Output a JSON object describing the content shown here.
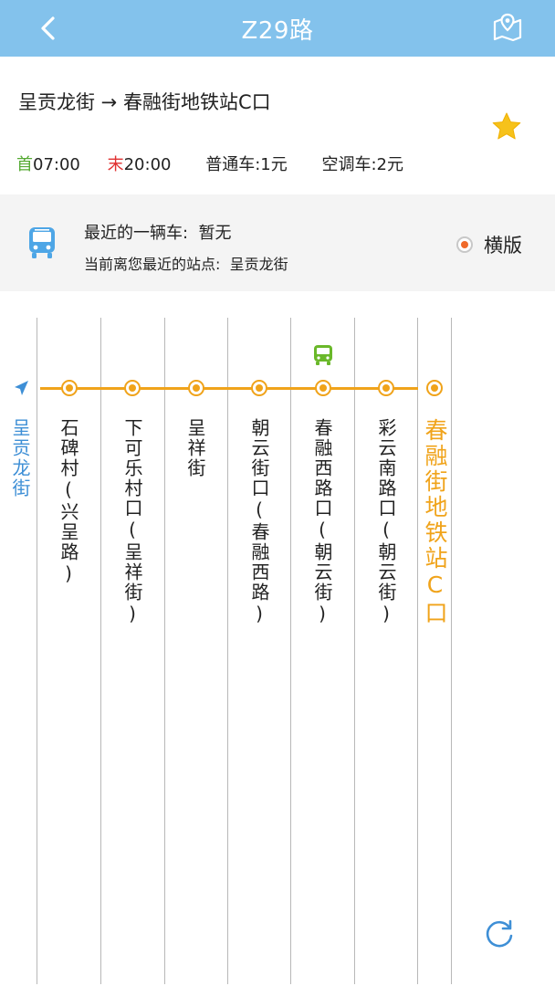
{
  "header": {
    "title": "Z29路",
    "back_icon": "chevron-left-icon",
    "map_icon": "map-pin-icon",
    "bar_color": "#83c2ec"
  },
  "route": {
    "title": "呈贡龙街 → 春融街地铁站C口",
    "first_label": "首",
    "first_time": "07:00",
    "last_label": "末",
    "last_time": "20:00",
    "normal_fare": "普通车:1元",
    "ac_fare": "空调车:2元",
    "favorite_icon": "star-icon"
  },
  "status": {
    "latest_bus": "最近的一辆车:  暂无",
    "nearest_stop": "当前离您最近的站点:  呈贡龙街",
    "layout_label": "横版",
    "layout_selected": true
  },
  "stops": [
    "呈贡龙街",
    "石碑村(兴呈路)",
    "下可乐村口(呈祥街)",
    "呈祥街",
    "朝云街口(春融西路)",
    "春融西路口(朝云街)",
    "彩云南路口(朝云街)",
    "春融街地铁站C口"
  ],
  "colors": {
    "route_line": "#f0a31a",
    "first_stop": "#3e8fd6",
    "bus_marker": "#6ab82a"
  }
}
